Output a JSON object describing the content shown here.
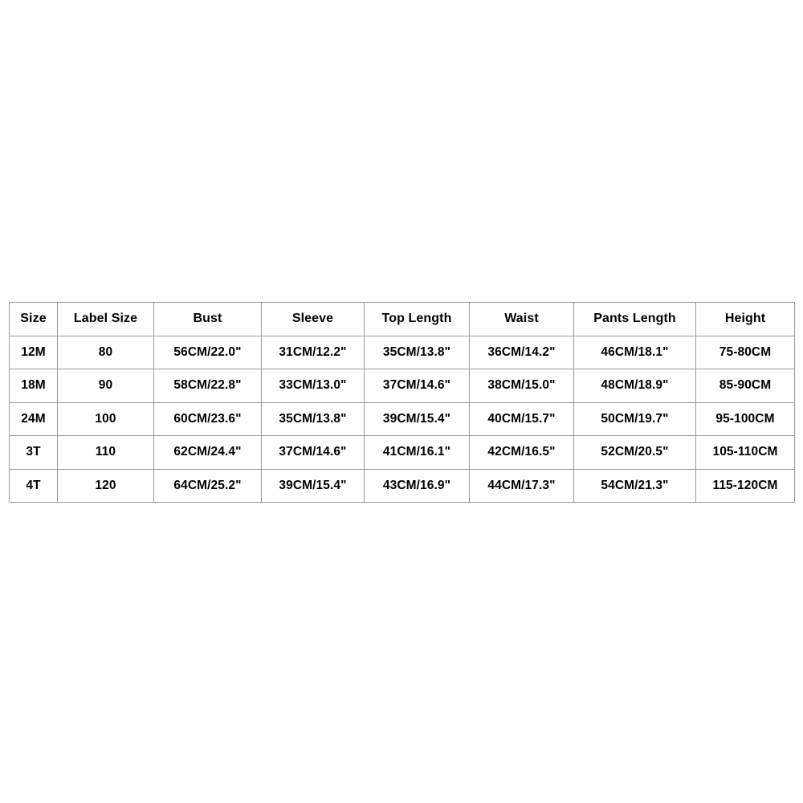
{
  "table": {
    "columns": [
      "Size",
      "Label Size",
      "Bust",
      "Sleeve",
      "Top Length",
      "Waist",
      "Pants Length",
      "Height"
    ],
    "rows": [
      {
        "size": "12M",
        "label_size": "80",
        "bust": "56CM/22.0\"",
        "sleeve": "31CM/12.2\"",
        "top_length": "35CM/13.8\"",
        "waist": "36CM/14.2\"",
        "pants_length": "46CM/18.1\"",
        "height": "75-80CM"
      },
      {
        "size": "18M",
        "label_size": "90",
        "bust": "58CM/22.8\"",
        "sleeve": "33CM/13.0\"",
        "top_length": "37CM/14.6\"",
        "waist": "38CM/15.0\"",
        "pants_length": "48CM/18.9\"",
        "height": "85-90CM"
      },
      {
        "size": "24M",
        "label_size": "100",
        "bust": "60CM/23.6\"",
        "sleeve": "35CM/13.8\"",
        "top_length": "39CM/15.4\"",
        "waist": "40CM/15.7\"",
        "pants_length": "50CM/19.7\"",
        "height": "95-100CM"
      },
      {
        "size": "3T",
        "label_size": "110",
        "bust": "62CM/24.4\"",
        "sleeve": "37CM/14.6\"",
        "top_length": "41CM/16.1\"",
        "waist": "42CM/16.5\"",
        "pants_length": "52CM/20.5\"",
        "height": "105-110CM"
      },
      {
        "size": "4T",
        "label_size": "120",
        "bust": "64CM/25.2\"",
        "sleeve": "39CM/15.4\"",
        "top_length": "43CM/16.9\"",
        "waist": "44CM/17.3\"",
        "pants_length": "54CM/21.3\"",
        "height": "115-120CM"
      }
    ]
  },
  "colors": {
    "background": "#ffffff",
    "border": "#9a9a9a",
    "text": "#000000"
  }
}
